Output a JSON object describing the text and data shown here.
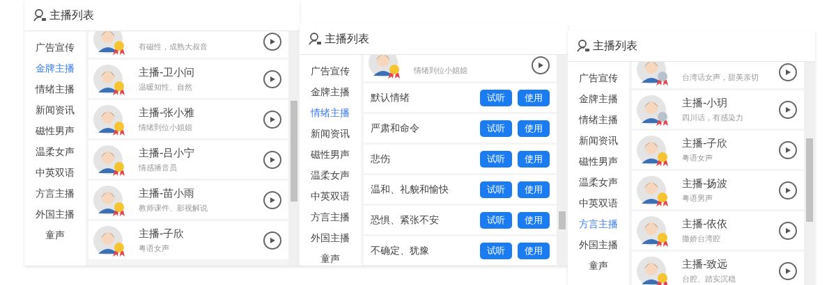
{
  "panels": [
    {
      "title": "主播列表",
      "categories": [
        {
          "label": "广告宣传",
          "selected": false
        },
        {
          "label": "金牌主播",
          "selected": true
        },
        {
          "label": "情绪主播",
          "selected": false
        },
        {
          "label": "新闻资讯",
          "selected": false
        },
        {
          "label": "磁性男声",
          "selected": false
        },
        {
          "label": "温柔女声",
          "selected": false
        },
        {
          "label": "中英双语",
          "selected": false
        },
        {
          "label": "方言主播",
          "selected": false
        },
        {
          "label": "外国主播",
          "selected": false
        },
        {
          "label": "童声",
          "selected": false
        }
      ],
      "items": [
        {
          "kind": "anchor",
          "partial": true,
          "description": "有磁性，成熟大叔音",
          "color": "#f5c430"
        },
        {
          "kind": "anchor",
          "name": "主播-卫小问",
          "description": "温暖知性、自然",
          "color": "#f5c430"
        },
        {
          "kind": "anchor",
          "name": "主播-张小雅",
          "description": "情绪到位小姐姐",
          "color": "#f5c430"
        },
        {
          "kind": "anchor",
          "name": "主播-吕小宁",
          "description": "情感播音员",
          "color": "#f5c430"
        },
        {
          "kind": "anchor",
          "name": "主播-苗小雨",
          "description": "教师课件、影视解说",
          "color": "#f5c430"
        },
        {
          "kind": "anchor",
          "name": "主播-子欣",
          "description": "粤语女声",
          "color": "#f5c430"
        }
      ]
    },
    {
      "title": "主播列表",
      "categories": [
        {
          "label": "广告宣传",
          "selected": false
        },
        {
          "label": "金牌主播",
          "selected": false
        },
        {
          "label": "情绪主播",
          "selected": true
        },
        {
          "label": "新闻资讯",
          "selected": false
        },
        {
          "label": "磁性男声",
          "selected": false
        },
        {
          "label": "温柔女声",
          "selected": false
        },
        {
          "label": "中英双语",
          "selected": false
        },
        {
          "label": "方言主播",
          "selected": false
        },
        {
          "label": "外国主播",
          "selected": false
        },
        {
          "label": "童声",
          "selected": false
        }
      ],
      "items": [
        {
          "kind": "anchor",
          "partial": true,
          "description": "情绪到位小姐姐",
          "color": "#f5c430"
        },
        {
          "kind": "emotion",
          "name": "默认情绪",
          "listen": "试听",
          "use": "使用"
        },
        {
          "kind": "emotion",
          "name": "严肃和命令",
          "listen": "试听",
          "use": "使用"
        },
        {
          "kind": "emotion",
          "name": "悲伤",
          "listen": "试听",
          "use": "使用"
        },
        {
          "kind": "emotion",
          "name": "温和、礼貌和愉快",
          "listen": "试听",
          "use": "使用"
        },
        {
          "kind": "emotion",
          "name": "恐惧、紧张不安",
          "listen": "试听",
          "use": "使用"
        },
        {
          "kind": "emotion",
          "name": "不确定、犹豫",
          "listen": "试听",
          "use": "使用"
        }
      ]
    },
    {
      "title": "主播列表",
      "categories": [
        {
          "label": "广告宣传",
          "selected": false
        },
        {
          "label": "金牌主播",
          "selected": false
        },
        {
          "label": "情绪主播",
          "selected": false
        },
        {
          "label": "新闻资讯",
          "selected": false
        },
        {
          "label": "磁性男声",
          "selected": false
        },
        {
          "label": "温柔女声",
          "selected": false
        },
        {
          "label": "中英双语",
          "selected": false
        },
        {
          "label": "方言主播",
          "selected": true
        },
        {
          "label": "外国主播",
          "selected": false
        },
        {
          "label": "童声",
          "selected": false
        }
      ],
      "items": [
        {
          "kind": "anchor",
          "partial": true,
          "description": "台湾话女声，甜美亲切",
          "color": "#b8c2cc"
        },
        {
          "kind": "anchor",
          "name": "主播-小玥",
          "description": "四川话，有感染力",
          "color": "#b8c2cc"
        },
        {
          "kind": "anchor",
          "name": "主播-子欣",
          "description": "粤语女声",
          "color": "#f5c430"
        },
        {
          "kind": "anchor",
          "name": "主播-扬波",
          "description": "粤语男声",
          "color": "#f5c430"
        },
        {
          "kind": "anchor",
          "name": "主播-依依",
          "description": "撒娇台湾腔",
          "color": "#f5c430"
        },
        {
          "kind": "anchor",
          "name": "主播-致远",
          "description": "台腔、踏实沉稳",
          "color": "#f5c430"
        }
      ]
    }
  ]
}
